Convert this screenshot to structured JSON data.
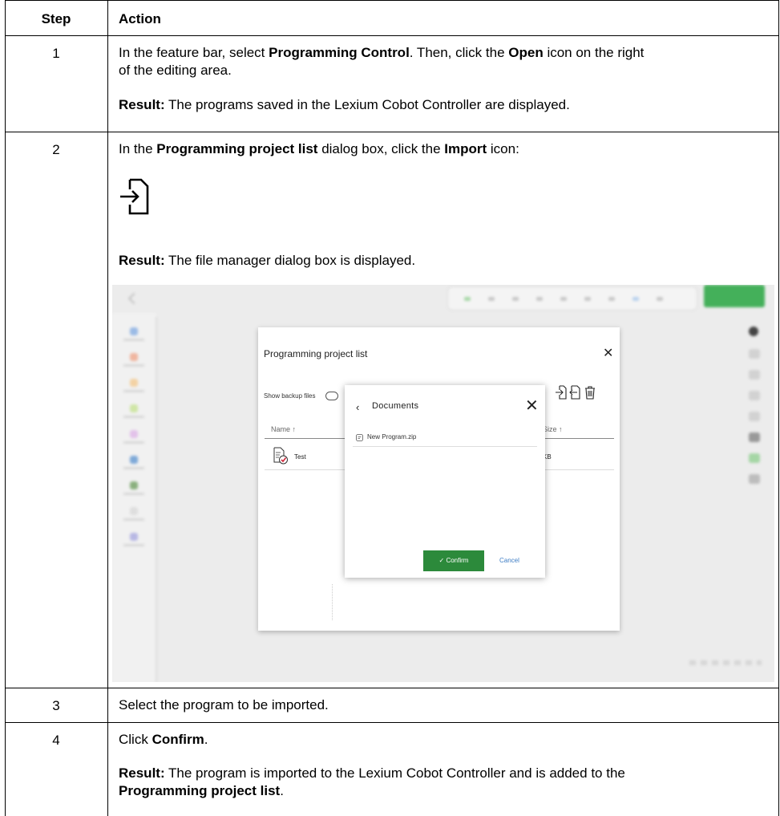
{
  "table": {
    "headers": {
      "step": "Step",
      "action": "Action"
    },
    "rows": [
      {
        "step": "1",
        "line1": {
          "pre": "In the feature bar, select ",
          "b1": "Programming Control",
          "mid": ". Then, click the ",
          "b2": "Open",
          "post": " icon on the right"
        },
        "line2": "of the editing area.",
        "result": {
          "label": "Result:",
          "text": " The programs saved in the Lexium Cobot Controller are displayed."
        }
      },
      {
        "step": "2",
        "line1": {
          "pre": "In the ",
          "b1": "Programming project list",
          "mid": " dialog box, click the ",
          "b2": "Import",
          "post": " icon:"
        },
        "icon": "import-icon",
        "result": {
          "label": "Result:",
          "text": " The file manager dialog box is displayed."
        }
      },
      {
        "step": "3",
        "text": "Select the program to be imported."
      },
      {
        "step": "4",
        "line1": {
          "pre": "Click ",
          "b1": "Confirm",
          "post": "."
        },
        "result": {
          "label": "Result:",
          "text": " The program is imported to the Lexium Cobot Controller and is added to the"
        },
        "result_line2": {
          "b1": "Programming project list",
          "post": "."
        }
      }
    ]
  },
  "screenshot": {
    "project_dialog": {
      "title": "Programming project list",
      "close": "✕",
      "backup_label": "Show backup files",
      "col_name": "Name ↑",
      "col_size": "Size ↑",
      "row_name": "Test",
      "row_size": "KB",
      "toolbar_icons": [
        "import-icon",
        "export-icon",
        "delete-icon"
      ]
    },
    "file_dialog": {
      "back": "‹",
      "title": "Documents",
      "close": "✕",
      "file": "New Program.zip",
      "confirm": "✓  Confirm",
      "cancel": "Cancel"
    },
    "colors": {
      "confirm_green": "#2c8a3b",
      "cancel_blue": "#3c7cc4",
      "app_green": "#44b05a"
    }
  }
}
